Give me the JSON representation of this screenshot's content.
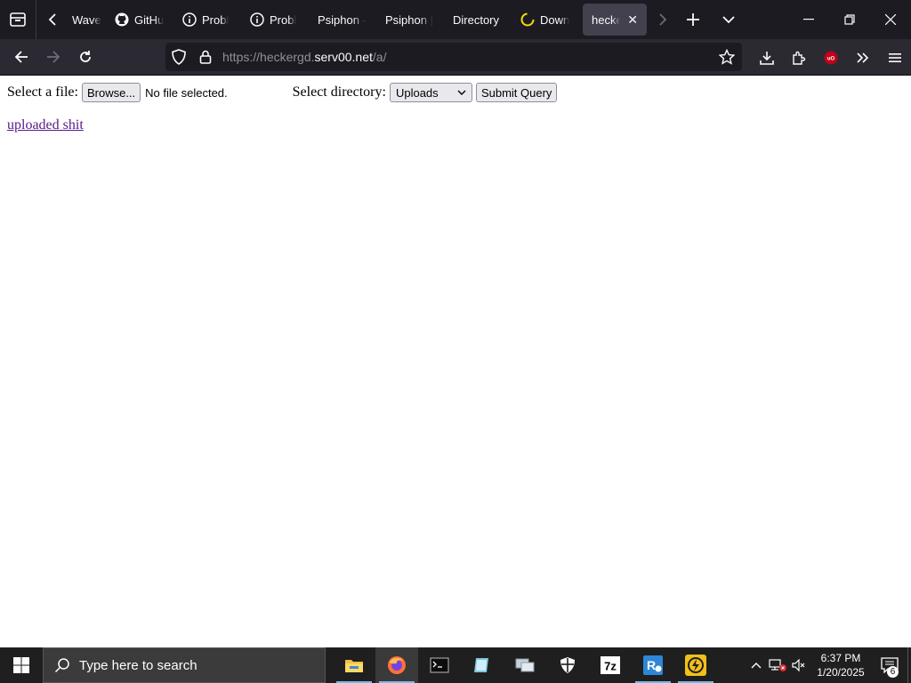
{
  "browser": {
    "tabs": [
      {
        "label": "Wave",
        "icon": "wave-icon"
      },
      {
        "label": "GitHu",
        "icon": "github-icon"
      },
      {
        "label": "Probl",
        "icon": "info-icon"
      },
      {
        "label": "Probl",
        "icon": "info-icon"
      },
      {
        "label": "Psiphon -",
        "icon": "none"
      },
      {
        "label": "Psiphon |",
        "icon": "none"
      },
      {
        "label": "Directory",
        "icon": "none"
      },
      {
        "label": "Down",
        "icon": "loading-spinner-icon"
      },
      {
        "label": "hecker",
        "icon": "none",
        "active": true
      }
    ],
    "url": {
      "prefix": "https://",
      "subdomain": "heckergd.",
      "domain": "serv00.net",
      "path": "/a/"
    }
  },
  "page": {
    "file_label": "Select a file:",
    "browse_button": "Browse...",
    "file_status": "No file selected.",
    "dir_label": "Select directory:",
    "dir_selected": "Uploads",
    "submit_button": "Submit Query",
    "link_text": "uploaded shit"
  },
  "taskbar": {
    "search_placeholder": "Type here to search",
    "time": "6:37 PM",
    "date": "1/20/2025",
    "notification_count": "6"
  },
  "colors": {
    "chrome_dark": "#1c1b22",
    "toolbar": "#2b2a33",
    "visited_link": "#551a8b",
    "taskbar": "#1f1f1f",
    "accent": "#76b9ed"
  }
}
